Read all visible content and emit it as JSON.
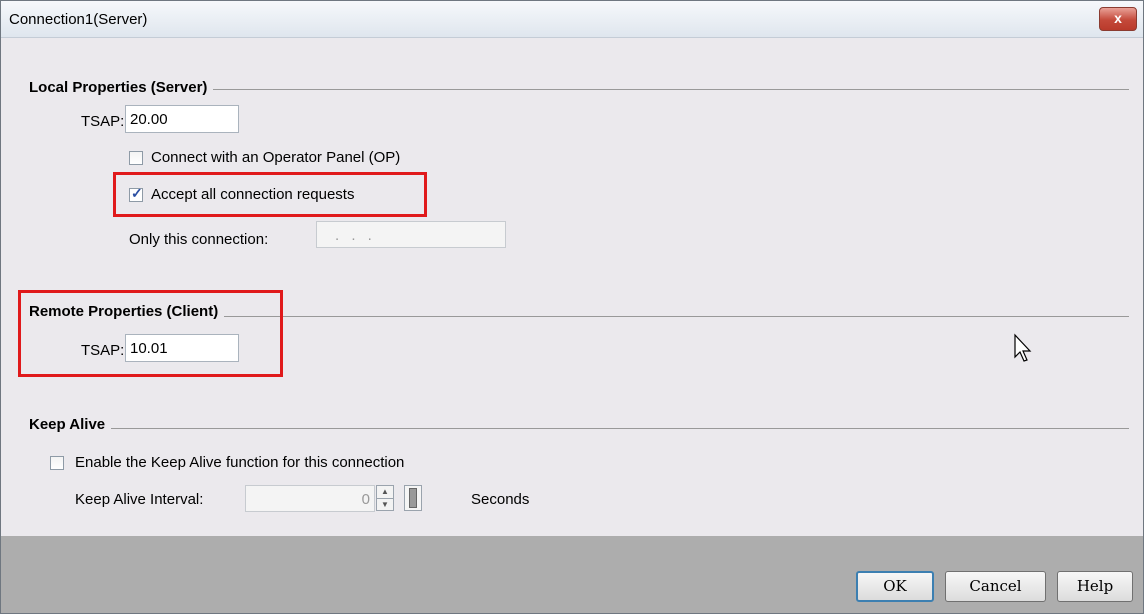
{
  "window": {
    "title": "Connection1(Server)",
    "close_label": "x"
  },
  "local": {
    "heading": "Local Properties (Server)",
    "tsap_label": "TSAP:",
    "tsap_value": "20.00",
    "op_checkbox_label": "Connect with an Operator Panel (OP)",
    "op_checked": false,
    "accept_checkbox_label": "Accept all connection requests",
    "accept_checked": true,
    "only_label": "Only this connection:",
    "only_value": ". . ."
  },
  "remote": {
    "heading": "Remote Properties (Client)",
    "tsap_label": "TSAP:",
    "tsap_value": "10.01"
  },
  "keepalive": {
    "heading": "Keep Alive",
    "enable_label": "Enable the Keep Alive function for this connection",
    "enable_checked": false,
    "interval_label": "Keep Alive  Interval:",
    "interval_value": "0",
    "unit": "Seconds"
  },
  "buttons": {
    "ok": "OK",
    "cancel": "Cancel",
    "help": "Help"
  },
  "icons": {
    "tick": "✓",
    "close": "close-icon",
    "spin_up": "▲",
    "spin_down": "▼",
    "cursor": "mouse-pointer-icon"
  },
  "colors": {
    "highlight": "#e0191b",
    "footer": "#adadad",
    "background": "#ebe9ed"
  }
}
